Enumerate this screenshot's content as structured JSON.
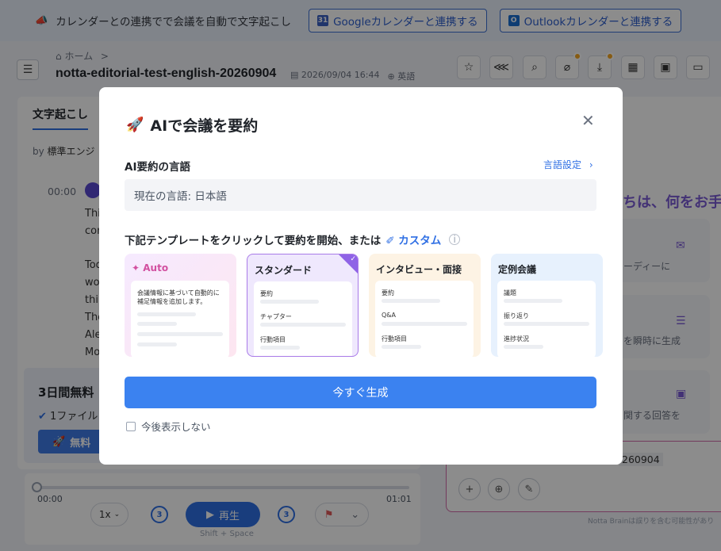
{
  "banner": {
    "text": "カレンダーとの連携でで会議を自動で文字起こし",
    "google_btn": "Googleカレンダーと連携する",
    "outlook_btn": "Outlookカレンダーと連携する"
  },
  "header": {
    "breadcrumb": "ホーム",
    "breadcrumb_sep": ">",
    "title": "notta-editorial-test-english-20260904",
    "datetime": "2026/09/04 16:44",
    "language": "英語"
  },
  "left": {
    "tab_label": "文字起こし",
    "by_label": "by",
    "engine": "標準エンジ",
    "timestamp": "00:00",
    "lines": [
      "Thi",
      "cor",
      "Tod",
      "wo",
      "thi",
      "The",
      "Ale",
      "Mo"
    ],
    "trial_title": "3日間無料",
    "trial_sub": "1ファイル",
    "trial_btn": "無料"
  },
  "player": {
    "time_start": "00:00",
    "time_end": "01:01",
    "speed": "1x",
    "skip_back": "3",
    "skip_fwd": "3",
    "play_label": "再生",
    "play_hint": "Shift + Space",
    "progress": 0
  },
  "right": {
    "greeting": "ちは、何をお手",
    "sugg1": "ーディーに",
    "sugg2": "を瞬時に生成",
    "sugg3": "関する回答を",
    "chat_snippet": "260904",
    "disclaimer": "Notta Brainは誤りを含む可能性があり"
  },
  "modal": {
    "title": "AIで会議を要約",
    "lang_label": "AI要約の言語",
    "lang_settings": "言語設定",
    "lang_current": "現在の言語: 日本語",
    "instruction": "下記テンプレートをクリックして要約を開始、または",
    "custom": "カスタム",
    "templates": [
      {
        "name": "Auto",
        "lines": [
          "会議情報に基づいて自動的に",
          "補足情報を追加します。"
        ]
      },
      {
        "name": "スタンダード",
        "lines": [
          "要約",
          "チャプター",
          "行動項目"
        ]
      },
      {
        "name": "インタビュー・面接",
        "lines": [
          "要約",
          "Q&A",
          "行動項目"
        ]
      },
      {
        "name": "定例会議",
        "lines": [
          "議題",
          "振り返り",
          "進捗状況"
        ]
      }
    ],
    "generate_btn": "今すぐ生成",
    "dont_show": "今後表示しない",
    "selected_template": "スタンダード"
  },
  "colors": {
    "accent": "#2f6fe4",
    "generate": "#3b82f0",
    "selected_border": "#a97ae8",
    "auto_label": "#d250a0"
  }
}
